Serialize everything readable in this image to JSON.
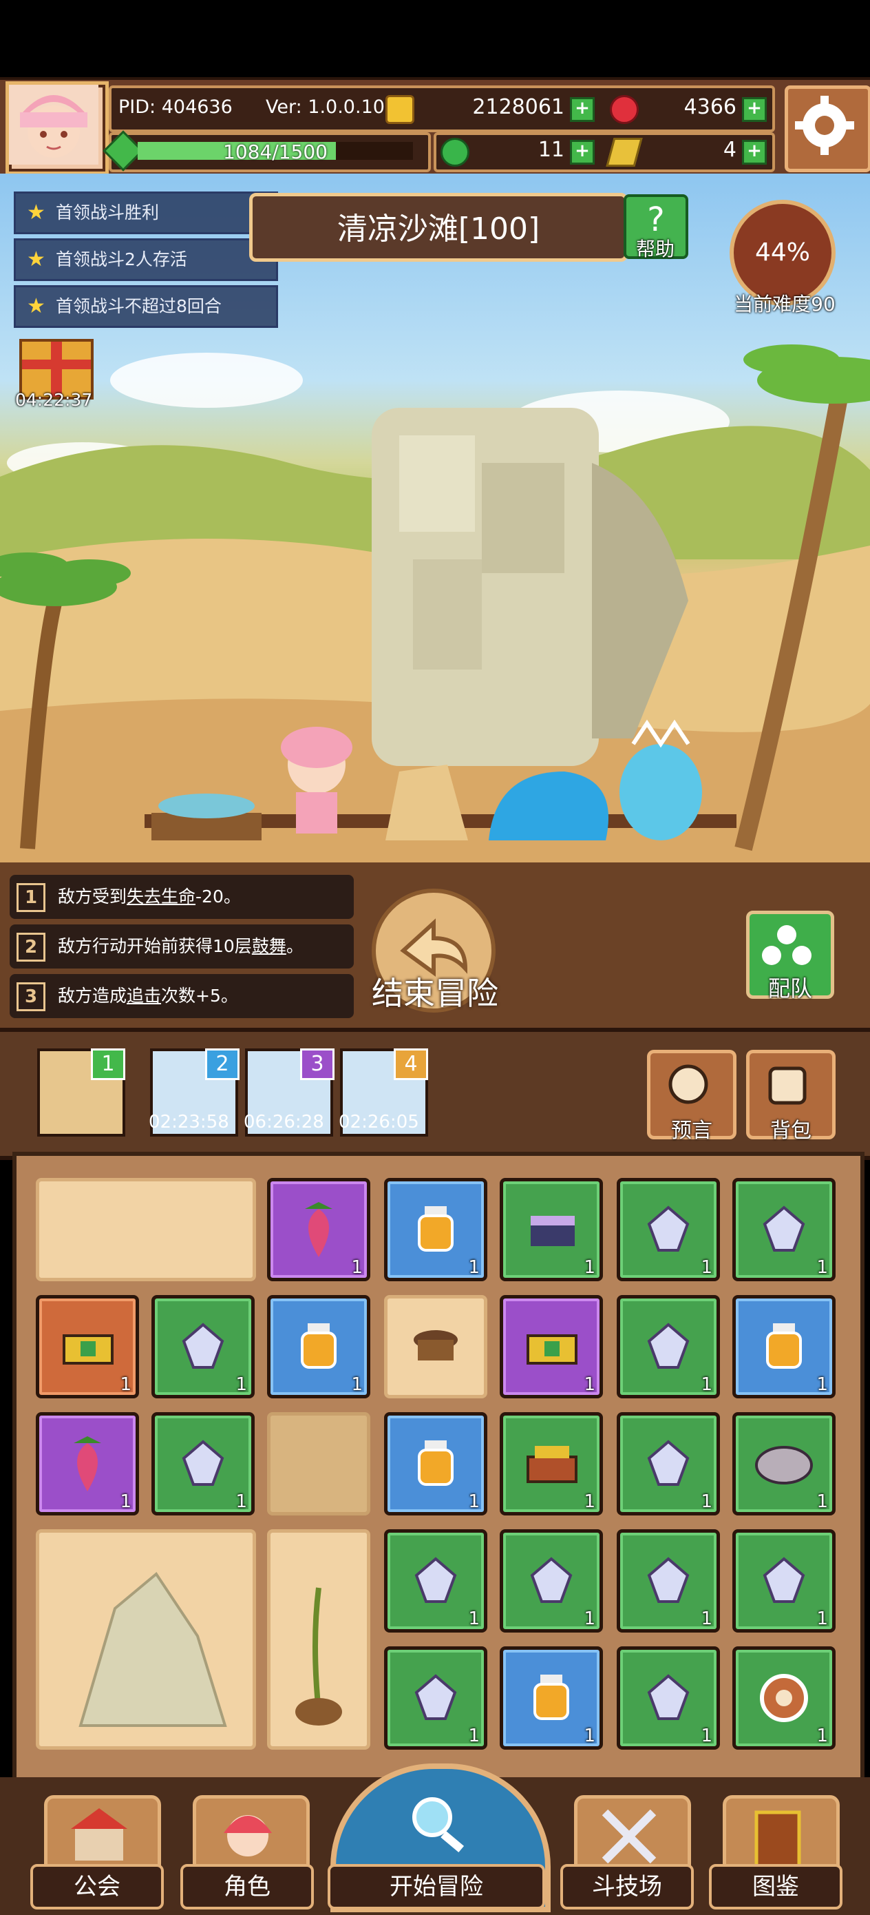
{
  "header": {
    "pid": "PID: 404636",
    "version": "Ver: 1.0.0.10",
    "gold": "2128061",
    "gems": "4366",
    "energy": "1084/1500",
    "energy_fraction": 0.72,
    "clover": "11",
    "keys": "4"
  },
  "quests": [
    "首领战斗胜利",
    "首领战斗2人存活",
    "首领战斗不超过8回合"
  ],
  "gift_timer": "04:22:37",
  "stage": {
    "title": "清凉沙滩[100]",
    "help_label": "帮助"
  },
  "difficulty": {
    "percent": "44%",
    "label": "当前难度90"
  },
  "skills": [
    {
      "num": "1",
      "pre": "敌方受到",
      "kw": "失去生命",
      "post": "-20。"
    },
    {
      "num": "2",
      "pre": "敌方行动开始前获得10层",
      "kw": "鼓舞",
      "post": "。"
    },
    {
      "num": "3",
      "pre": "敌方造成",
      "kw": "追击",
      "post": "次数+5。"
    }
  ],
  "end_adventure": "结束冒险",
  "team_label": "配队",
  "stage_slots": [
    {
      "badge": "1",
      "timer": ""
    },
    {
      "badge": "2",
      "timer": "02:23:58"
    },
    {
      "badge": "3",
      "timer": "06:26:28"
    },
    {
      "badge": "4",
      "timer": "02:26:05"
    }
  ],
  "prophecy_label": "预言",
  "bag_label": "背包",
  "inventory_qty": "1",
  "nav": {
    "guild": "公会",
    "character": "角色",
    "start": "开始冒险",
    "arena": "斗技场",
    "codex": "图鉴"
  },
  "colors": {
    "rarity_green": "#45a24e",
    "rarity_blue": "#4b8fd8",
    "rarity_purple": "#9b4fc9",
    "rarity_orange": "#cf6a3b"
  }
}
